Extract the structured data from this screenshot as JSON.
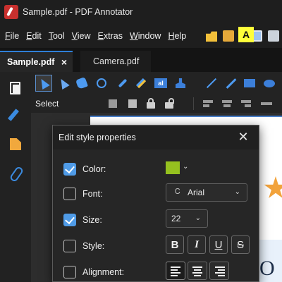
{
  "window": {
    "title": "Sample.pdf - PDF Annotator"
  },
  "menu": {
    "items": [
      {
        "key": "F",
        "rest": "ile"
      },
      {
        "key": "E",
        "rest": "dit"
      },
      {
        "key": "T",
        "rest": "ool"
      },
      {
        "key": "V",
        "rest": "iew"
      },
      {
        "key": "E",
        "rest": "xtras"
      },
      {
        "key": "W",
        "rest": "indow"
      },
      {
        "key": "H",
        "rest": "elp"
      }
    ]
  },
  "tabs": {
    "active": "Sample.pdf",
    "inactive": "Camera.pdf",
    "close_glyph": "×"
  },
  "toolbar": {
    "mode_label": "Select",
    "text_tool_glyph": "aI"
  },
  "document": {
    "yellow_note_letter": "A",
    "big_text_fragment": "O"
  },
  "dialog": {
    "title": "Edit style properties",
    "close_glyph": "✕",
    "rows": {
      "color": {
        "label": "Color:",
        "checked": true,
        "value_color": "#95c11f"
      },
      "font": {
        "label": "Font:",
        "checked": false,
        "value": "Arial",
        "glyph": "Ꮯ"
      },
      "size": {
        "label": "Size:",
        "checked": true,
        "value": "22"
      },
      "style": {
        "label": "Style:",
        "checked": false,
        "buttons": [
          "B",
          "I",
          "U",
          "S"
        ]
      },
      "alignment": {
        "label": "Alignment:",
        "checked": false,
        "options": [
          "left",
          "center",
          "right"
        ],
        "selected": "left"
      }
    }
  },
  "colors": {
    "accent": "#2f7fd8",
    "checkbox_on": "#4f9be7",
    "app_icon": "#c8302e"
  }
}
